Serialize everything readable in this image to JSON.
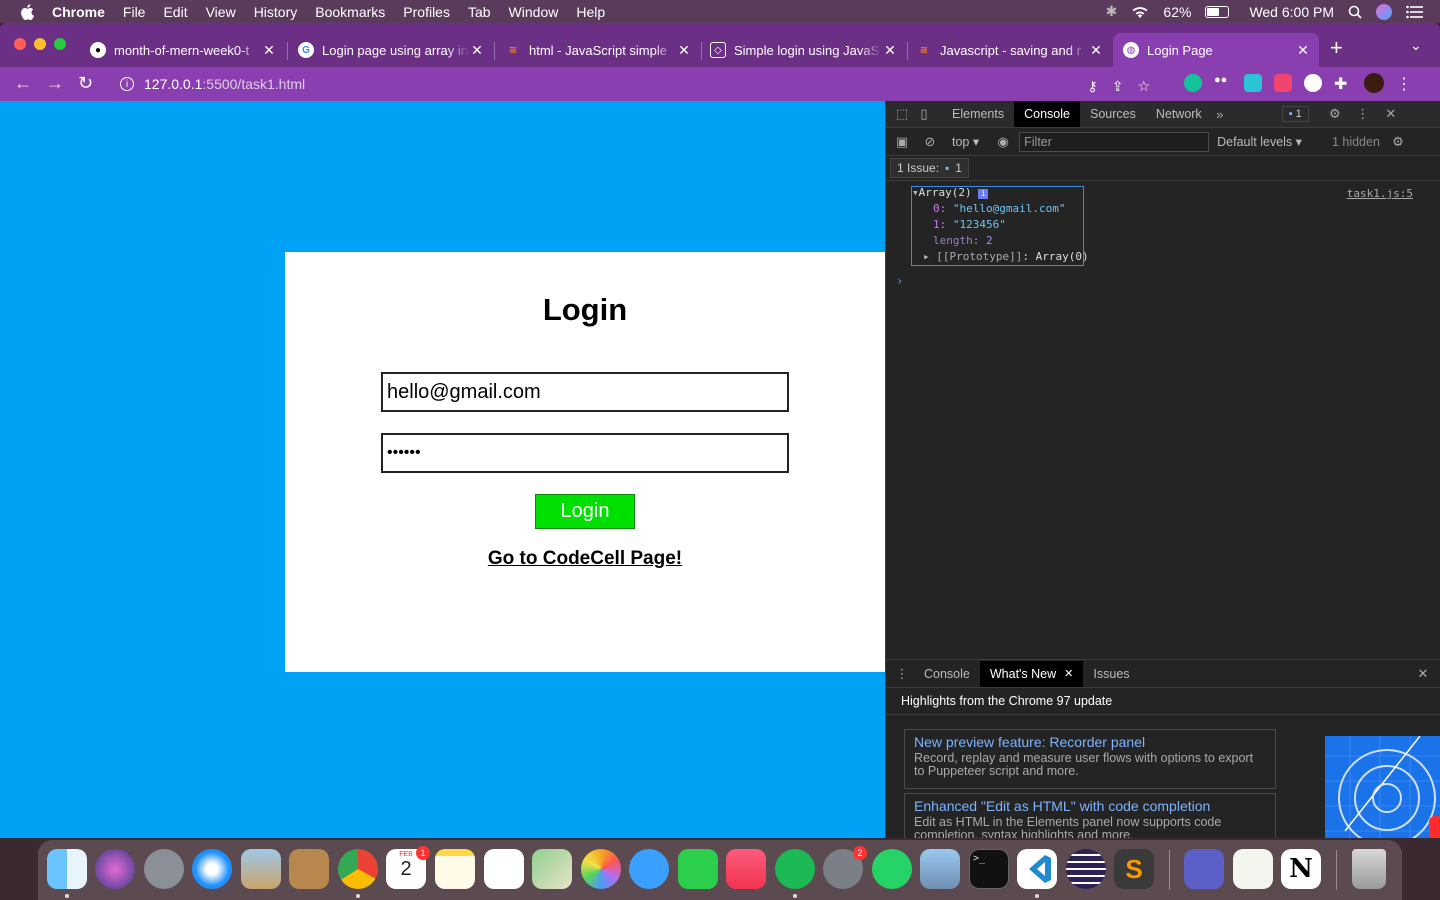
{
  "menubar": {
    "app": "Chrome",
    "items": [
      "File",
      "Edit",
      "View",
      "History",
      "Bookmarks",
      "Profiles",
      "Tab",
      "Window",
      "Help"
    ],
    "battery": "62%",
    "clock": "Wed 6:00 PM"
  },
  "tabs": [
    {
      "title": "month-of-mern-week0-t",
      "icon": "github-icon"
    },
    {
      "title": "Login page using array in",
      "icon": "google-icon"
    },
    {
      "title": "html - JavaScript simple",
      "icon": "stackoverflow-icon"
    },
    {
      "title": "Simple login using JavaS",
      "icon": "codepen-icon"
    },
    {
      "title": "Javascript - saving and r",
      "icon": "stackoverflow-icon"
    },
    {
      "title": "Login Page",
      "icon": "globe-icon",
      "active": true
    }
  ],
  "address": {
    "host": "127.0.0.1",
    "rest": ":5500/task1.html"
  },
  "page": {
    "heading": "Login",
    "email_value": "hello@gmail.com",
    "password_value": "••••••",
    "login_button": "Login",
    "link_text": "Go to CodeCell Page!",
    "background_color": "#00a2f5",
    "button_color": "#00e000"
  },
  "devtools": {
    "tabs": [
      "Elements",
      "Console",
      "Sources",
      "Network"
    ],
    "active_tab": "Console",
    "message_count": "1",
    "context": "top",
    "filter_placeholder": "Filter",
    "levels": "Default levels",
    "hidden": "1 hidden",
    "issues_label": "1 Issue:",
    "issues_count": "1",
    "log": {
      "header": "Array(2)",
      "items": [
        {
          "key": "0",
          "value": "\"hello@gmail.com\""
        },
        {
          "key": "1",
          "value": "\"123456\""
        }
      ],
      "length_key": "length",
      "length_value": "2",
      "proto_key": "[[Prototype]]",
      "proto_value": "Array(0)",
      "source": "task1.js:5"
    },
    "drawer": {
      "tabs": [
        "Console",
        "What's New",
        "Issues"
      ],
      "active": "What's New",
      "title": "Highlights from the Chrome 97 update",
      "features": [
        {
          "title": "New preview feature: Recorder panel",
          "desc": "Record, replay and measure user flows with options to export to Puppeteer script and more."
        },
        {
          "title": "Enhanced \"Edit as HTML\" with code completion",
          "desc": "Edit as HTML in the Elements panel now supports code completion, syntax highlights and more."
        }
      ]
    }
  },
  "dock": {
    "apps": [
      "finder-icon",
      "siri-icon",
      "launchpad-icon",
      "safari-icon",
      "mail-icon",
      "contacts-icon",
      "chrome-icon",
      "calendar-icon",
      "notes-icon",
      "reminders-icon",
      "maps-icon",
      "photos-icon",
      "messages-icon",
      "facetime-icon",
      "music-icon",
      "spotify-icon",
      "system-preferences-icon",
      "whatsapp-icon",
      "preview-icon",
      "terminal-icon",
      "vscode-icon",
      "eclipse-icon",
      "sublime-icon",
      "teams-icon",
      "textedit-icon",
      "notion-icon",
      "trash-icon"
    ],
    "calendar_month": "FEB",
    "calendar_day": "2",
    "calendar_badge": "1",
    "settings_badge": "2"
  }
}
